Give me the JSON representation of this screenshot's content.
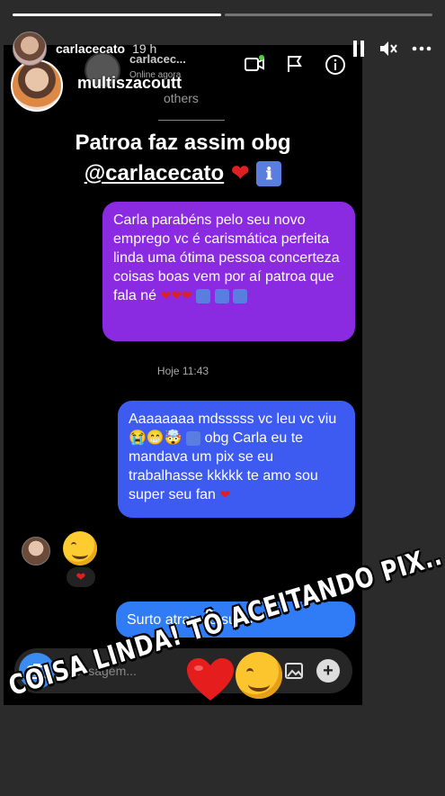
{
  "story": {
    "username": "carlacecato",
    "time": "19 h",
    "progress": [
      1,
      0
    ]
  },
  "screenshot": {
    "chat_name": "carlacec...",
    "chat_status": "Online agora",
    "overlay_name": "multiszacoutt",
    "others": "others",
    "caption_line1": "Patroa faz assim obg",
    "caption_mention": "@carlacecato",
    "messages": [
      {
        "text": "Carla parabéns pelo seu novo emprego vc é carismática perfeita linda uma ótima pessoa concerteza coisas boas vem por aí patroa que fala né"
      },
      {
        "text": "Aaaaaaaa mdsssss vc leu vc viu",
        "text2": "obg Carla eu te mandava um pix se eu trabalhasse kkkkk te amo sou super seu fan"
      },
      {
        "text": "Surto atraz de surto"
      }
    ],
    "timestamp": "Hoje 11:43",
    "composer_placeholder": "Mensagem..."
  },
  "sticker": {
    "text": "COISA LINDA! TÔ ACEITANDO PIX.."
  },
  "colors": {
    "bubble_purple": "#8a2be2",
    "bubble_blue": "#3d5af1",
    "heart": "#e02020"
  }
}
